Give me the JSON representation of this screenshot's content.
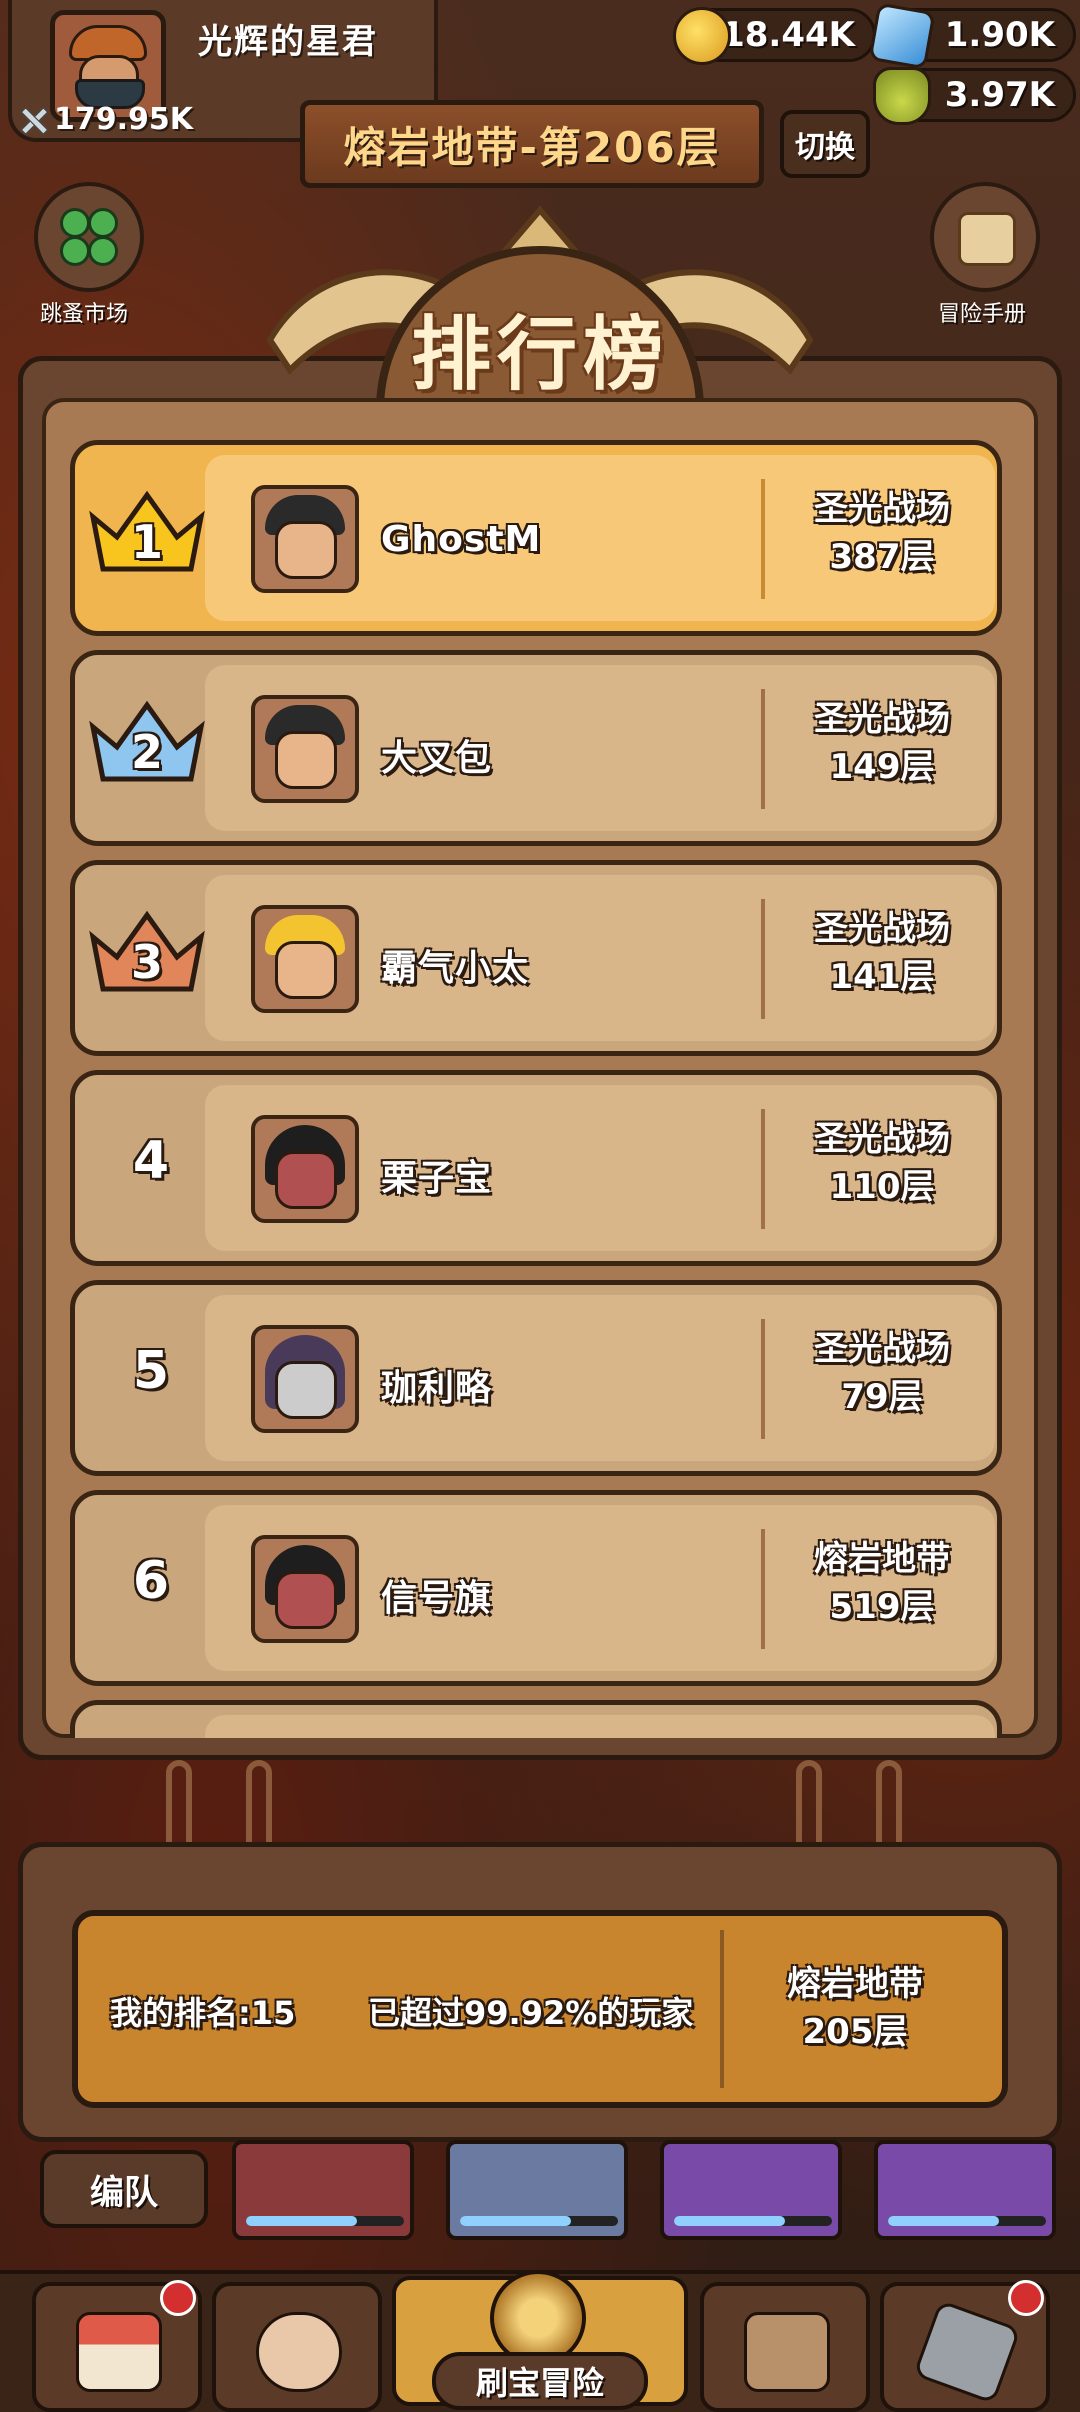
{
  "player": {
    "name": "光辉的星君",
    "power": "179.95K"
  },
  "resources": {
    "gold": "18.44K",
    "gem": "1.90K",
    "potion": "3.97K"
  },
  "level": {
    "title": "熔岩地带-第206层",
    "switch_label": "切换"
  },
  "side": {
    "left_label": "跳蚤市场",
    "right_label": "冒险手册"
  },
  "leaderboard": {
    "title": "排行榜",
    "rows": [
      {
        "rank": "1",
        "name": "GhostM",
        "stage_name": "圣光战场",
        "floor": "387层"
      },
      {
        "rank": "2",
        "name": "大叉包",
        "stage_name": "圣光战场",
        "floor": "149层"
      },
      {
        "rank": "3",
        "name": "霸气小太",
        "stage_name": "圣光战场",
        "floor": "141层"
      },
      {
        "rank": "4",
        "name": "栗子宝",
        "stage_name": "圣光战场",
        "floor": "110层"
      },
      {
        "rank": "5",
        "name": "珈利略",
        "stage_name": "圣光战场",
        "floor": "79层"
      },
      {
        "rank": "6",
        "name": "信号旗",
        "stage_name": "熔岩地带",
        "floor": "519层"
      }
    ]
  },
  "my_rank": {
    "rank_text": "我的排名:15",
    "percent_text": "已超过99.92%的玩家",
    "stage_name": "熔岩地带",
    "floor": "205层"
  },
  "team": {
    "label": "编队"
  },
  "nav": {
    "adventure_label": "刷宝冒险"
  }
}
